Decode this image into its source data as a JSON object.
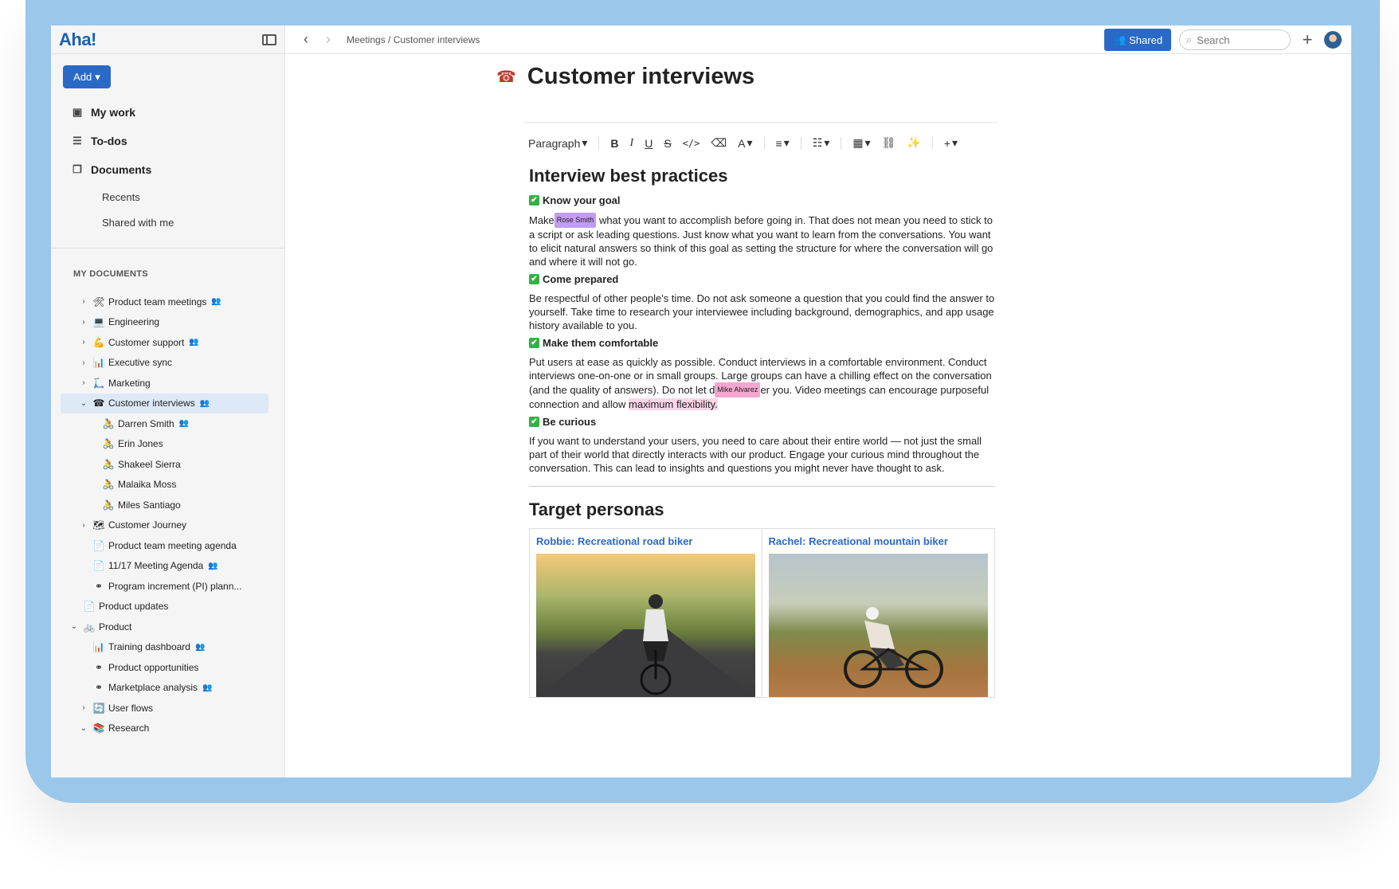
{
  "app": {
    "logo": "Aha!"
  },
  "sidebar": {
    "add_label": "Add",
    "nav": [
      {
        "label": "My work",
        "icon": "briefcase-icon"
      },
      {
        "label": "To-dos",
        "icon": "checklist-icon"
      },
      {
        "label": "Documents",
        "icon": "documents-icon"
      }
    ],
    "doc_sub": [
      "Recents",
      "Shared with me"
    ],
    "section_title": "MY DOCUMENTS",
    "tree": [
      {
        "label": "Product team meetings",
        "emoji": "🛠",
        "chevron": "›",
        "shared": true
      },
      {
        "label": "Engineering",
        "emoji": "💻",
        "chevron": "›",
        "shared": false
      },
      {
        "label": "Customer support",
        "emoji": "💪",
        "chevron": "›",
        "shared": true
      },
      {
        "label": "Executive sync",
        "emoji": "📊",
        "chevron": "›",
        "shared": false
      },
      {
        "label": "Marketing",
        "emoji": "🛴",
        "chevron": "›",
        "shared": false
      },
      {
        "label": "Customer interviews",
        "emoji": "☎",
        "chevron": "⌄",
        "shared": true,
        "active": true
      },
      {
        "label": "Darren Smith",
        "emoji": "🚴",
        "shared": true
      },
      {
        "label": "Erin Jones",
        "emoji": "🚴",
        "shared": false
      },
      {
        "label": "Shakeel Sierra",
        "emoji": "🚴",
        "shared": false
      },
      {
        "label": "Malaika Moss",
        "emoji": "🚴",
        "shared": false
      },
      {
        "label": "Miles Santiago",
        "emoji": "🚴",
        "shared": false
      },
      {
        "label": "Customer Journey",
        "emoji": "🗺",
        "chevron": "›",
        "shared": false
      },
      {
        "label": "Product team meeting agenda",
        "emoji": "📄",
        "shared": false
      },
      {
        "label": "11/17 Meeting Agenda",
        "emoji": "📄",
        "shared": true
      },
      {
        "label": "Program increment (PI) plann...",
        "emoji": "⚭",
        "shared": false
      },
      {
        "label": "Product updates",
        "emoji": "📄",
        "shared": false
      },
      {
        "label": "Product",
        "emoji": "🚲",
        "chevron": "⌄",
        "shared": false
      },
      {
        "label": "Training dashboard",
        "emoji": "📊",
        "shared": true
      },
      {
        "label": "Product opportunities",
        "emoji": "⚭",
        "shared": false
      },
      {
        "label": "Marketplace analysis",
        "emoji": "⚭",
        "shared": true
      },
      {
        "label": "User flows",
        "emoji": "🔄",
        "chevron": "›",
        "shared": false
      },
      {
        "label": "Research",
        "emoji": "📚",
        "chevron": "⌄",
        "shared": false
      }
    ]
  },
  "topbar": {
    "breadcrumb": "Meetings / Customer interviews",
    "shared_label": "Shared",
    "search_placeholder": "Search"
  },
  "document": {
    "title": "Customer interviews",
    "toolbar": {
      "paragraph": "Paragraph"
    },
    "heading1": "Interview best practices",
    "sections": [
      {
        "title": "Know your goal"
      },
      {
        "title": "Come prepared",
        "body": "Be respectful of other people's time. Do not ask someone a question that you could find the answer to yourself. Take time to research your interviewee including background, demographics, and app usage history available to you."
      },
      {
        "title": "Make them comfortable"
      },
      {
        "title": "Be curious",
        "body": "If you want to understand your users, you need to care about their entire world — not just the small part of their world that directly interacts with our product. Engage your curious mind throughout the conversation. This can lead to insights and questions you might never have thought to ask."
      }
    ],
    "goal_text_a": "Make",
    "goal_cursor": "Rose Smith",
    "goal_text_b": " what you want to accomplish before going in. That does not mean you need to stick to a script or ask leading questions. Just know what you want to learn from the conversations. You want to elicit natural answers so think of this goal as setting the structure for where the conversation will go and where it will not go.",
    "comfort_text_a": "Put users at ease as quickly as possible. Conduct interviews in a comfortable environment. Conduct interviews one-on-one or in small groups. Large groups can have a chilling effect on the conversation (and the quality of answers). Do not let d",
    "comfort_cursor": "Mike Alvarez",
    "comfort_text_b": "er you. Video meetings can encourage purposeful connection and allow ",
    "comfort_highlight": "maximum flexibility.",
    "heading2": "Target personas",
    "personas": [
      {
        "link": "Robbie: Recreational road biker"
      },
      {
        "link": "Rachel: Recreational mountain biker"
      }
    ]
  },
  "colors": {
    "accent": "#2b69c6",
    "frame": "#9bc7ea",
    "check": "#2fb344"
  }
}
